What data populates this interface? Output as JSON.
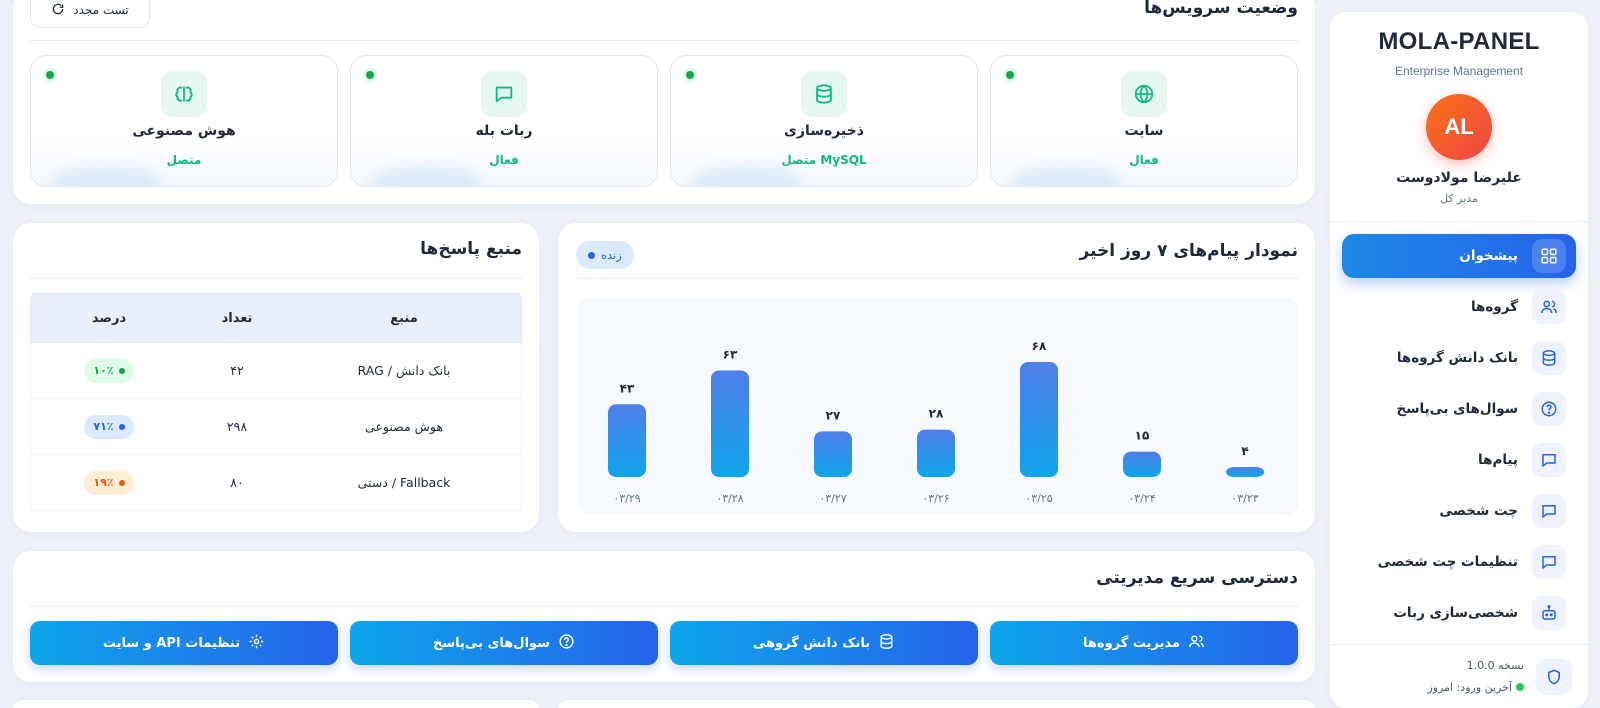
{
  "sidebar": {
    "brand": "MOLA-PANEL",
    "subtitle": "Enterprise Management",
    "avatar_initials": "AL",
    "user_name": "علیرضا مولادوست",
    "user_role": "مدیر کل",
    "items": [
      {
        "label": "پیشخوان",
        "icon": "grid-icon",
        "active": true
      },
      {
        "label": "گروه‌ها",
        "icon": "users-icon"
      },
      {
        "label": "بانک دانش گروه‌ها",
        "icon": "database-icon"
      },
      {
        "label": "سوال‌های بی‌پاسخ",
        "icon": "question-icon"
      },
      {
        "label": "پیام‌ها",
        "icon": "message-icon"
      },
      {
        "label": "چت شخصی",
        "icon": "message-icon"
      },
      {
        "label": "تنظیمات چت شخصی",
        "icon": "message-icon"
      },
      {
        "label": "شخصی‌سازی ربات",
        "icon": "robot-icon"
      }
    ],
    "version": "نسخه 1.0.0",
    "last_login": "آخرین ورود: امروز"
  },
  "services": {
    "title": "وضعیت سرویس‌ها",
    "retest_label": "تست مجدد",
    "items": [
      {
        "name": "سایت",
        "status": "فعال",
        "icon": "globe-icon"
      },
      {
        "name": "ذخیره‌سازی",
        "status": "MySQL متصل",
        "icon": "database-icon"
      },
      {
        "name": "ربات بله",
        "status": "فعال",
        "icon": "message-icon"
      },
      {
        "name": "هوش مصنوعی",
        "status": "متصل",
        "icon": "brain-icon"
      }
    ]
  },
  "chart_card": {
    "title": "نمودار پیام‌های ۷ روز اخیر",
    "badge": "زنده"
  },
  "chart_data": {
    "type": "bar",
    "categories": [
      "۰۳/۲۹",
      "۰۳/۲۸",
      "۰۳/۲۷",
      "۰۳/۲۶",
      "۰۳/۲۵",
      "۰۳/۲۴",
      "۰۳/۲۳"
    ],
    "values": [
      43,
      63,
      27,
      28,
      68,
      15,
      4
    ],
    "value_labels": [
      "۴۳",
      "۶۳",
      "۲۷",
      "۲۸",
      "۶۸",
      "۱۵",
      "۴"
    ],
    "colors": {
      "bar_top": "#4f7fe8",
      "bar_bottom": "#0ea5e9"
    }
  },
  "sources": {
    "title": "منبع پاسخ‌ها",
    "headers": {
      "source": "منبع",
      "count": "تعداد",
      "percent": "درصد"
    },
    "rows": [
      {
        "source": "بانک دانش / RAG",
        "count": "۴۲",
        "percent": "۱۰٪",
        "color": "#16a34a",
        "bg": "#dcfce7"
      },
      {
        "source": "هوش مصنوعی",
        "count": "۲۹۸",
        "percent": "۷۱٪",
        "color": "#2563eb",
        "bg": "#dbeafe"
      },
      {
        "source": "Fallback / دستی",
        "count": "۸۰",
        "percent": "۱۹٪",
        "color": "#ea580c",
        "bg": "#ffedd5"
      }
    ]
  },
  "quick_access": {
    "title": "دسترسی سریع مدیریتی",
    "buttons": [
      {
        "label": "مدیریت گروه‌ها",
        "icon": "users-icon"
      },
      {
        "label": "بانک دانش گروهی",
        "icon": "database-icon"
      },
      {
        "label": "سوال‌های بی‌پاسخ",
        "icon": "question-icon"
      },
      {
        "label": "تنظیمات API و سایت",
        "icon": "gear-icon"
      }
    ]
  }
}
